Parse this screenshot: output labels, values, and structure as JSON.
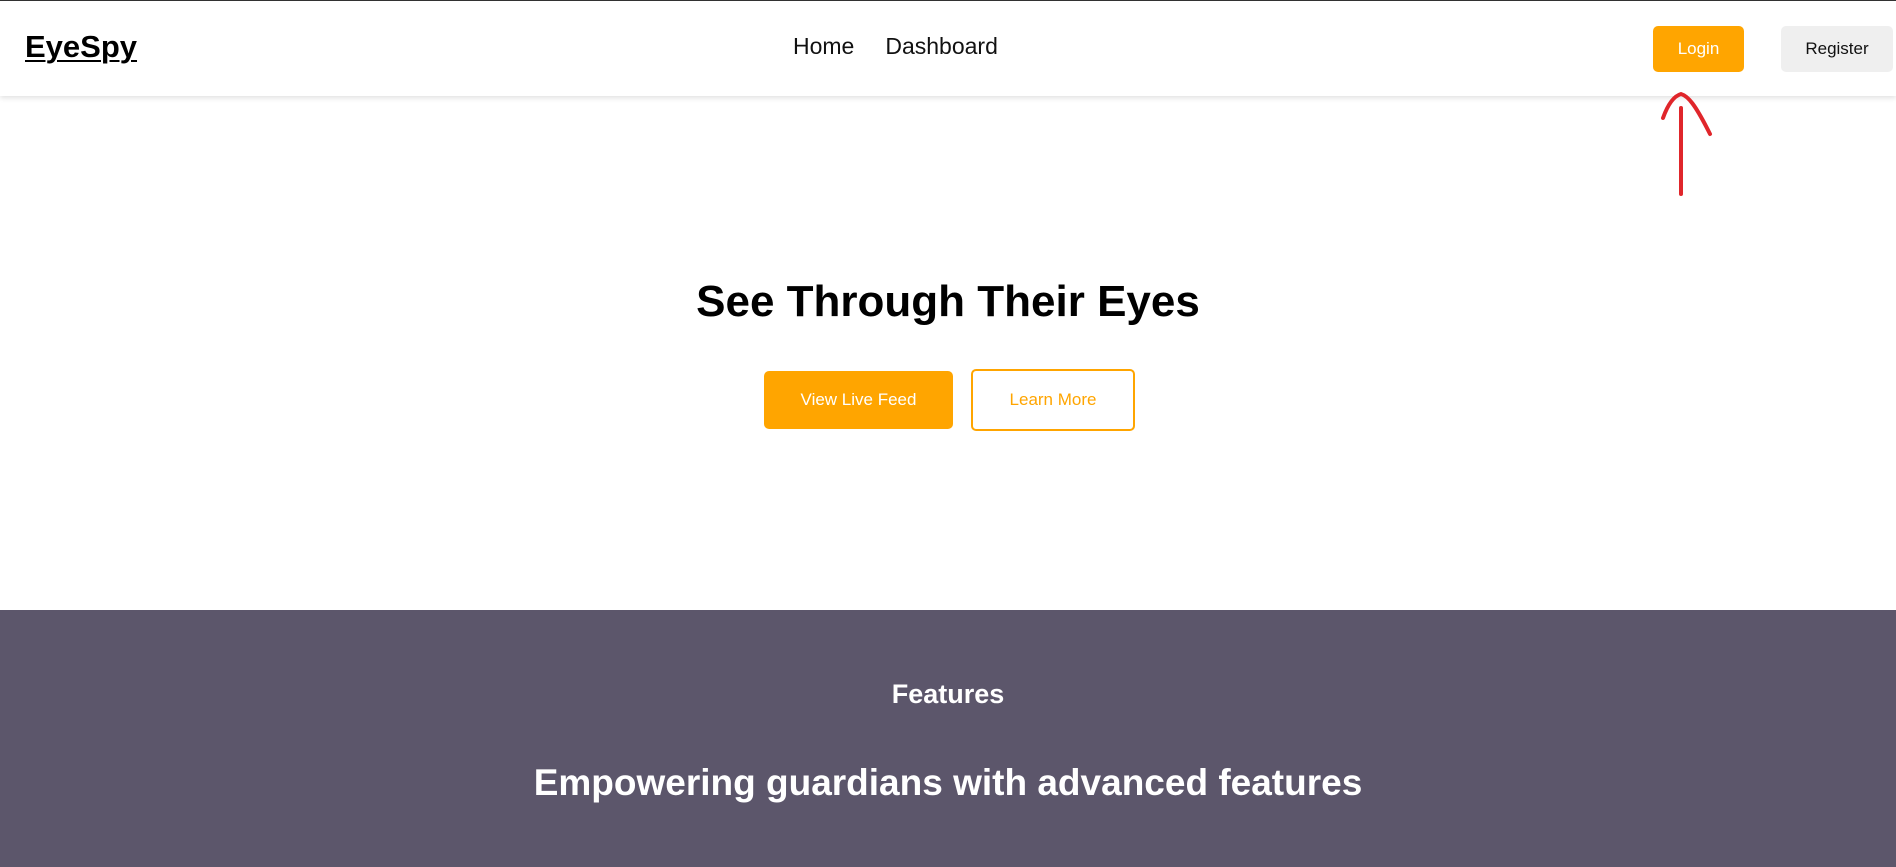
{
  "header": {
    "logo": "EyeSpy",
    "nav": [
      {
        "label": "Home"
      },
      {
        "label": "Dashboard"
      }
    ],
    "login_label": "Login",
    "register_label": "Register"
  },
  "hero": {
    "title": "See Through Their Eyes",
    "primary_button": "View Live Feed",
    "secondary_button": "Learn More"
  },
  "features": {
    "label": "Features",
    "title": "Empowering guardians with advanced features"
  },
  "annotation": {
    "icon": "red-arrow-icon",
    "color": "#e0262b"
  },
  "colors": {
    "accent": "#ffa500",
    "features_bg": "#5c566b",
    "register_bg": "#efefef"
  }
}
